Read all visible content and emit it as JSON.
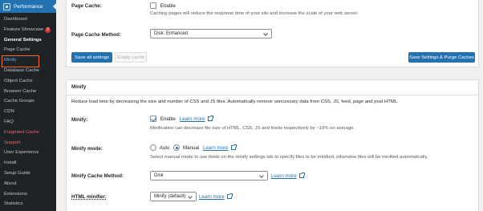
{
  "sidebar": {
    "header": "Performance",
    "items": [
      {
        "label": "Dashboard"
      },
      {
        "label": "Feature Showcase",
        "badge": "2"
      },
      {
        "label": "General Settings"
      },
      {
        "label": "Page Cache"
      },
      {
        "label": "Minify"
      },
      {
        "label": "Database Cache"
      },
      {
        "label": "Object Cache"
      },
      {
        "label": "Browser Cache"
      },
      {
        "label": "Cache Groups"
      },
      {
        "label": "CDN"
      },
      {
        "label": "FAQ"
      },
      {
        "label": "Fragment Cache"
      },
      {
        "label": "Support"
      },
      {
        "label": "User Experience"
      },
      {
        "label": "Install"
      },
      {
        "label": "Setup Guide"
      },
      {
        "label": "About"
      },
      {
        "label": "Extensions"
      },
      {
        "label": "Statistics"
      }
    ]
  },
  "page_cache": {
    "label": "Page Cache:",
    "checkbox_label": "Enable",
    "description": "Caching pages will reduce the response time of your site and increase the scale of your web server.",
    "method_label": "Page Cache Method:",
    "method_value": "Disk: Enhanced",
    "save_all": "Save all settings",
    "empty_cache": "Empty cache",
    "save_purge": "Save Settings & Purge Caches"
  },
  "minify": {
    "title": "Minify",
    "intro": "Reduce load time by decreasing the size and number of CSS and JS files. Automatically remove unncessary data from CSS, JS, feed, page and post HTML.",
    "enable_label": "Minify:",
    "enable_text": "Enable",
    "learn_more": "Learn more",
    "enable_desc": "Minification can decrease file size of HTML, CSS, JS and feeds respectively by ~10% on average.",
    "mode_label": "Minify mode:",
    "mode_auto": "Auto",
    "mode_manual": "Manual",
    "mode_desc": "Select manual mode to use fields on the minify settings tab to specify files to be minified, otherwise files will be minified automatically.",
    "cache_method_label": "Minify Cache Method:",
    "cache_method_value": "Disk",
    "html_minifier_label": "HTML minifier:",
    "html_minifier_value": "Minify (default)"
  },
  "colors": {
    "accent": "#2271b1",
    "sidebar_bg": "#1d2327",
    "highlight_border": "#f56e28",
    "badge": "#d63638"
  }
}
